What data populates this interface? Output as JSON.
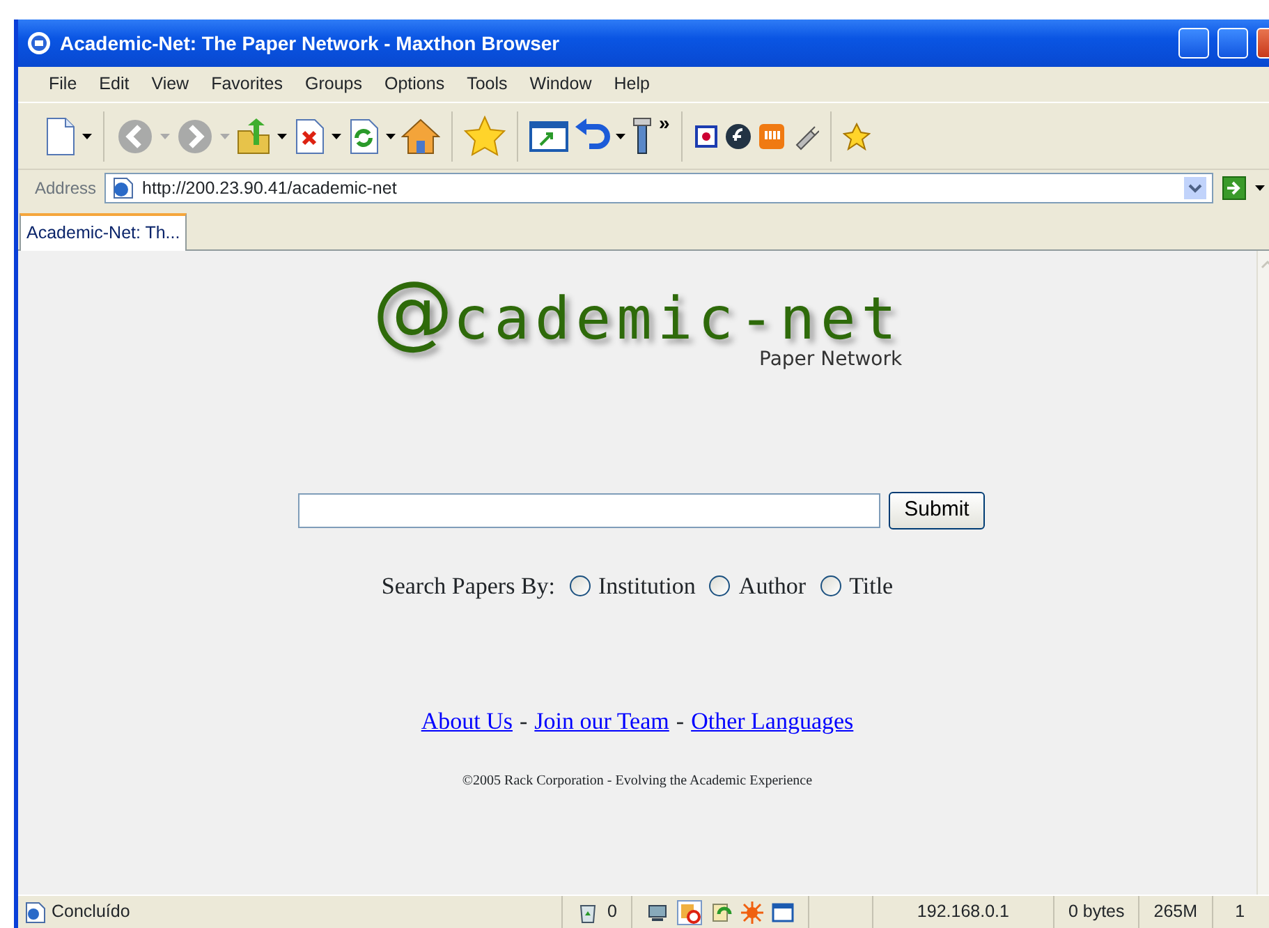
{
  "window": {
    "title": "Academic-Net: The Paper Network - Maxthon Browser"
  },
  "menu": [
    "File",
    "Edit",
    "View",
    "Favorites",
    "Groups",
    "Options",
    "Tools",
    "Window",
    "Help"
  ],
  "toolbar": {
    "overflow": "»"
  },
  "address_bar": {
    "label": "Address",
    "url": "http://200.23.90.41/academic-net"
  },
  "tabs": [
    {
      "label": "Academic-Net: Th...",
      "selected": true
    }
  ],
  "page": {
    "logo": {
      "mark": "@",
      "text": "cademic-net",
      "subtitle": "Paper Network"
    },
    "search": {
      "button": "Submit"
    },
    "search_by": {
      "label": "Search Papers By:",
      "options": [
        {
          "label": "Institution",
          "selected": false
        },
        {
          "label": "Author",
          "selected": false
        },
        {
          "label": "Title",
          "selected": false
        }
      ]
    },
    "links": [
      {
        "text": "About Us"
      },
      {
        "text": "Join our Team"
      },
      {
        "text": "Other Languages"
      }
    ],
    "separator": "-",
    "copyright": "©2005 Rack Corporation - Evolving the Academic Experience"
  },
  "status_bar": {
    "status": "Concluído",
    "count": "0",
    "ip": "192.168.0.1",
    "traffic": "0 bytes",
    "memory": "265M",
    "pages": "1"
  }
}
